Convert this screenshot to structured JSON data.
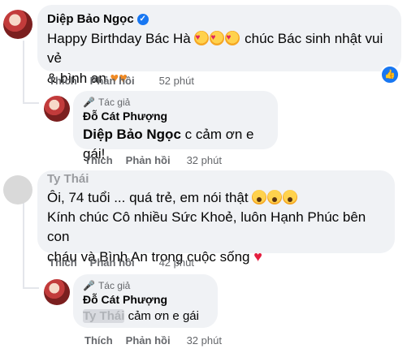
{
  "comments": [
    {
      "author": "Diệp Bảo Ngọc",
      "text_before": "Happy Birthday Bác Hà",
      "text_after": "chúc Bác sinh nhật vui vẻ",
      "text_line2": "& bình an",
      "like": "Thích",
      "reply": "Phản hồi",
      "time": "52 phút",
      "reaction_icon": "like-icon"
    },
    {
      "author_tag": "Tác giả",
      "author": "Đỗ Cát Phượng",
      "mention": "Diệp Bảo Ngọc",
      "text": "c cảm ơn e gái!",
      "like": "Thích",
      "reply": "Phản hồi",
      "time": "32 phút"
    },
    {
      "author": "Ty Thái",
      "line1": "Ôi, 74 tuổi ... quá trẻ, em nói thật",
      "line2": "Kính chúc Cô nhiều Sức Khoẻ, luôn Hạnh Phúc bên con",
      "line3": "cháu và Bình An trong cuộc sống",
      "like": "Thích",
      "reply": "Phản hồi",
      "time": "42 phút"
    },
    {
      "author_tag": "Tác giả",
      "author": "Đỗ Cát Phượng",
      "mention": "Ty Thái",
      "text": "cảm ơn e gái",
      "like": "Thích",
      "reply": "Phản hồi",
      "time": "32 phút"
    }
  ],
  "colors": {
    "accent": "#1877f2",
    "bubble": "#f0f2f5",
    "muted": "#65676b"
  }
}
